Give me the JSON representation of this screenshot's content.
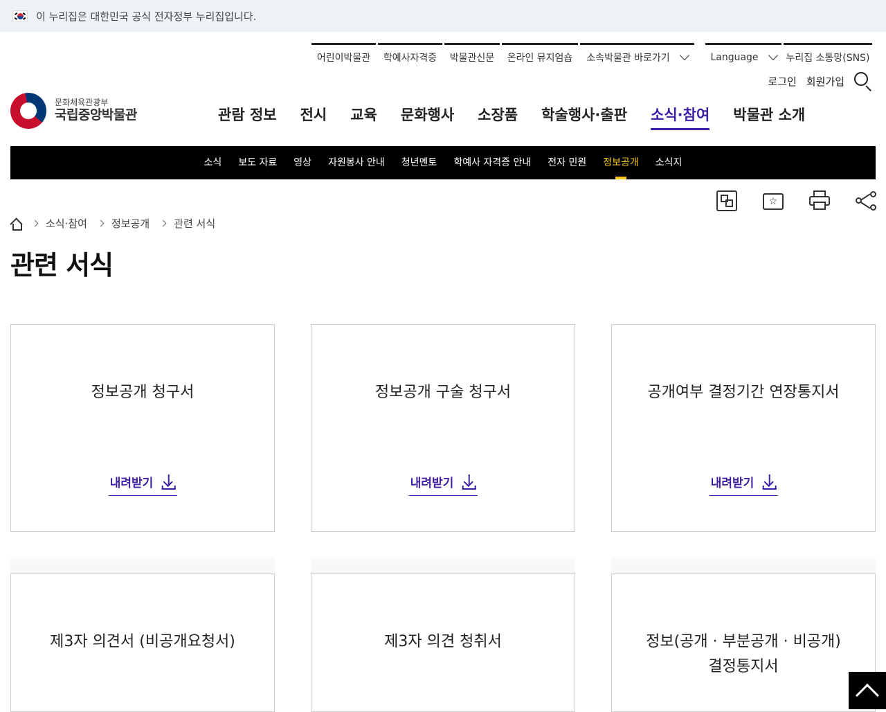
{
  "gov_banner": {
    "text": "이 누리집은 대한민국 공식 전자정부 누리집입니다."
  },
  "utility": {
    "links": [
      "어린이박물관",
      "학예사자격증",
      "박물관신문",
      "온라인 뮤지엄숍"
    ],
    "affiliates": "소속박물관 바로가기",
    "language": "Language",
    "sns": "누리집 소통망(SNS)"
  },
  "account": {
    "login": "로그인",
    "signup": "회원가입"
  },
  "logo": {
    "ministry": "문화체육관광부",
    "name": "국립중앙박물관"
  },
  "gnb": {
    "items": [
      "관람 정보",
      "전시",
      "교육",
      "문화행사",
      "소장품",
      "학술행사·출판",
      "소식·참여",
      "박물관 소개"
    ],
    "active_index": 6
  },
  "subnav": {
    "items": [
      "소식",
      "보도 자료",
      "영상",
      "자원봉사 안내",
      "청년멘토",
      "학예사 자격증 안내",
      "전자 민원",
      "정보공개",
      "소식지"
    ],
    "active_index": 7
  },
  "tools": [
    "qr-code-icon",
    "favorite-icon",
    "print-icon",
    "share-icon"
  ],
  "breadcrumb": [
    "소식·참여",
    "정보공개",
    "관련 서식"
  ],
  "page": {
    "title": "관련 서식"
  },
  "download_label": "내려받기",
  "cards": [
    {
      "title": "정보공개 청구서"
    },
    {
      "title": "정보공개 구술 청구서"
    },
    {
      "title": "공개여부 결정기간 연장통지서"
    },
    {
      "title": "제3자 의견서 (비공개요청서)"
    },
    {
      "title": "제3자 의견 청취서"
    },
    {
      "title": "정보(공개 · 부분공개 · 비공개) 결정통지서"
    }
  ],
  "colors": {
    "accent": "#3d1fa5",
    "subnav_active": "#f5c518",
    "gov_bar_bg": "#eef1f5"
  }
}
